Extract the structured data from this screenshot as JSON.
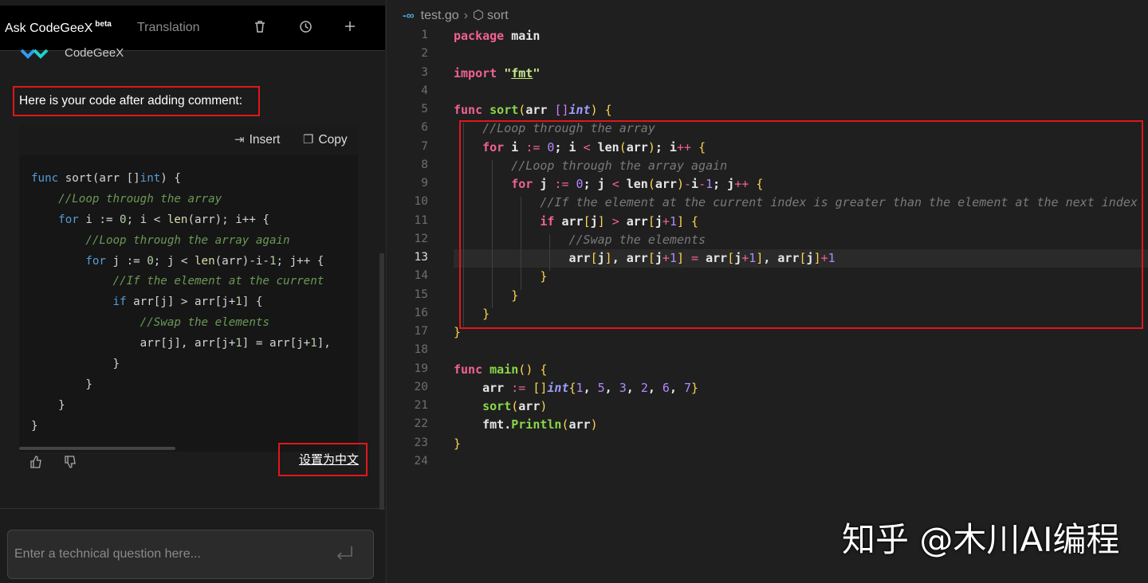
{
  "panel": {
    "tab_ask": "Ask CodeGeeX",
    "tab_ask_badge": "beta",
    "tab_translation": "Translation",
    "bot_name": "CodeGeeX",
    "message": "Here is your code after adding comment:",
    "insert_label": "Insert",
    "copy_label": "Copy",
    "code_lines": [
      "func sort(arr []int) {",
      "    //Loop through the array",
      "    for i := 0; i < len(arr); i++ {",
      "        //Loop through the array again",
      "        for j := 0; j < len(arr)-i-1; j++ {",
      "            //If the element at the current",
      "            if arr[j] > arr[j+1] {",
      "                //Swap the elements",
      "                arr[j], arr[j+1] = arr[j+1],",
      "            }",
      "        }",
      "    }",
      "}"
    ],
    "set_chinese_label": "设置为中文",
    "input_placeholder": "Enter a technical question here..."
  },
  "editor": {
    "breadcrumb_file": "test.go",
    "breadcrumb_symbol": "sort",
    "active_line": 13,
    "lines": [
      "package main",
      "",
      "import \"fmt\"",
      "",
      "func sort(arr []int) {",
      "    //Loop through the array",
      "    for i := 0; i < len(arr); i++ {",
      "        //Loop through the array again",
      "        for j := 0; j < len(arr)-i-1; j++ {",
      "            //If the element at the current index is greater than the element at the next index",
      "            if arr[j] > arr[j+1] {",
      "                //Swap the elements",
      "                arr[j], arr[j+1] = arr[j+1], arr[j]+1",
      "            }",
      "        }",
      "    }",
      "}",
      "",
      "func main() {",
      "    arr := []int{1, 5, 3, 2, 6, 7}",
      "    sort(arr)",
      "    fmt.Println(arr)",
      "}",
      ""
    ]
  },
  "watermark": "知乎 @木川AI编程",
  "colors": {
    "highlight_box": "#e0161c",
    "keyword": "#f06292",
    "function": "#8bd649",
    "comment": "#7a7a7a"
  },
  "icons": [
    "trash-icon",
    "history-icon",
    "plus-icon",
    "insert-icon",
    "copy-icon",
    "thumbs-up-icon",
    "thumbs-down-icon",
    "enter-icon",
    "go-file-icon",
    "cube-icon"
  ]
}
